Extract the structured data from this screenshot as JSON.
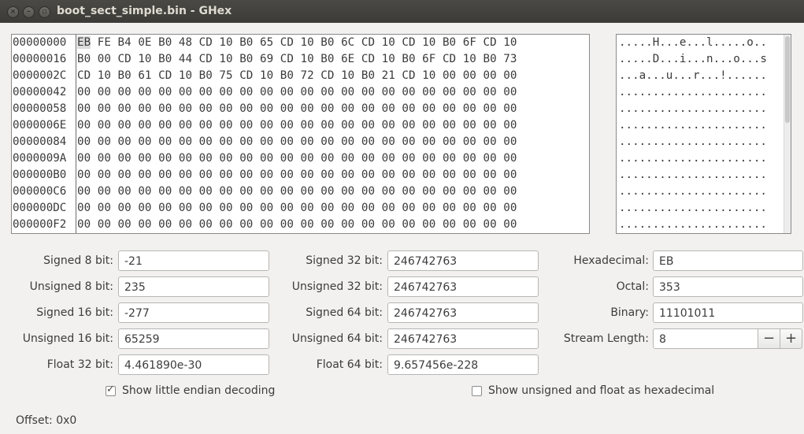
{
  "window": {
    "title": "boot_sect_simple.bin - GHex",
    "close_glyph": "×",
    "minimize_glyph": "–",
    "maximize_glyph": "▫"
  },
  "hex_view": {
    "offsets": [
      "00000000",
      "00000016",
      "0000002C",
      "00000042",
      "00000058",
      "0000006E",
      "00000084",
      "0000009A",
      "000000B0",
      "000000C6",
      "000000DC",
      "000000F2"
    ],
    "first_byte": "EB",
    "rows": [
      " FE B4 0E B0 48 CD 10 B0 65 CD 10 B0 6C CD 10 CD 10 B0 6F CD 10",
      "B0 00 CD 10 B0 44 CD 10 B0 69 CD 10 B0 6E CD 10 B0 6F CD 10 B0 73",
      "CD 10 B0 61 CD 10 B0 75 CD 10 B0 72 CD 10 B0 21 CD 10 00 00 00 00",
      "00 00 00 00 00 00 00 00 00 00 00 00 00 00 00 00 00 00 00 00 00 00",
      "00 00 00 00 00 00 00 00 00 00 00 00 00 00 00 00 00 00 00 00 00 00",
      "00 00 00 00 00 00 00 00 00 00 00 00 00 00 00 00 00 00 00 00 00 00",
      "00 00 00 00 00 00 00 00 00 00 00 00 00 00 00 00 00 00 00 00 00 00",
      "00 00 00 00 00 00 00 00 00 00 00 00 00 00 00 00 00 00 00 00 00 00",
      "00 00 00 00 00 00 00 00 00 00 00 00 00 00 00 00 00 00 00 00 00 00",
      "00 00 00 00 00 00 00 00 00 00 00 00 00 00 00 00 00 00 00 00 00 00",
      "00 00 00 00 00 00 00 00 00 00 00 00 00 00 00 00 00 00 00 00 00 00",
      "00 00 00 00 00 00 00 00 00 00 00 00 00 00 00 00 00 00 00 00 00 00"
    ],
    "ascii_rows": [
      ".....H...e...l.....o..",
      ".....D...i...n...o...s",
      "...a...u...r...!......",
      "......................",
      "......................",
      "......................",
      "......................",
      "......................",
      "......................",
      "......................",
      "......................",
      "......................"
    ]
  },
  "fields": {
    "signed_8": {
      "label": "Signed 8 bit:",
      "value": "-21"
    },
    "unsigned_8": {
      "label": "Unsigned 8 bit:",
      "value": "235"
    },
    "signed_16": {
      "label": "Signed 16 bit:",
      "value": "-277"
    },
    "unsigned_16": {
      "label": "Unsigned 16 bit:",
      "value": "65259"
    },
    "float_32": {
      "label": "Float 32 bit:",
      "value": "4.461890e-30"
    },
    "signed_32": {
      "label": "Signed 32 bit:",
      "value": "246742763"
    },
    "unsigned_32": {
      "label": "Unsigned 32 bit:",
      "value": "246742763"
    },
    "signed_64": {
      "label": "Signed 64 bit:",
      "value": "246742763"
    },
    "unsigned_64": {
      "label": "Unsigned 64 bit:",
      "value": "246742763"
    },
    "float_64": {
      "label": "Float 64 bit:",
      "value": "9.657456e-228"
    },
    "hexadecimal": {
      "label": "Hexadecimal:",
      "value": "EB"
    },
    "octal": {
      "label": "Octal:",
      "value": "353"
    },
    "binary": {
      "label": "Binary:",
      "value": "11101011"
    },
    "stream_length": {
      "label": "Stream Length:",
      "value": "8",
      "minus": "−",
      "plus": "+"
    }
  },
  "options": {
    "little_endian": {
      "label": "Show little endian decoding",
      "checked": true
    },
    "unsigned_hex": {
      "label": "Show unsigned and float as hexadecimal",
      "checked": false
    }
  },
  "status": {
    "offset": "Offset: 0x0"
  }
}
